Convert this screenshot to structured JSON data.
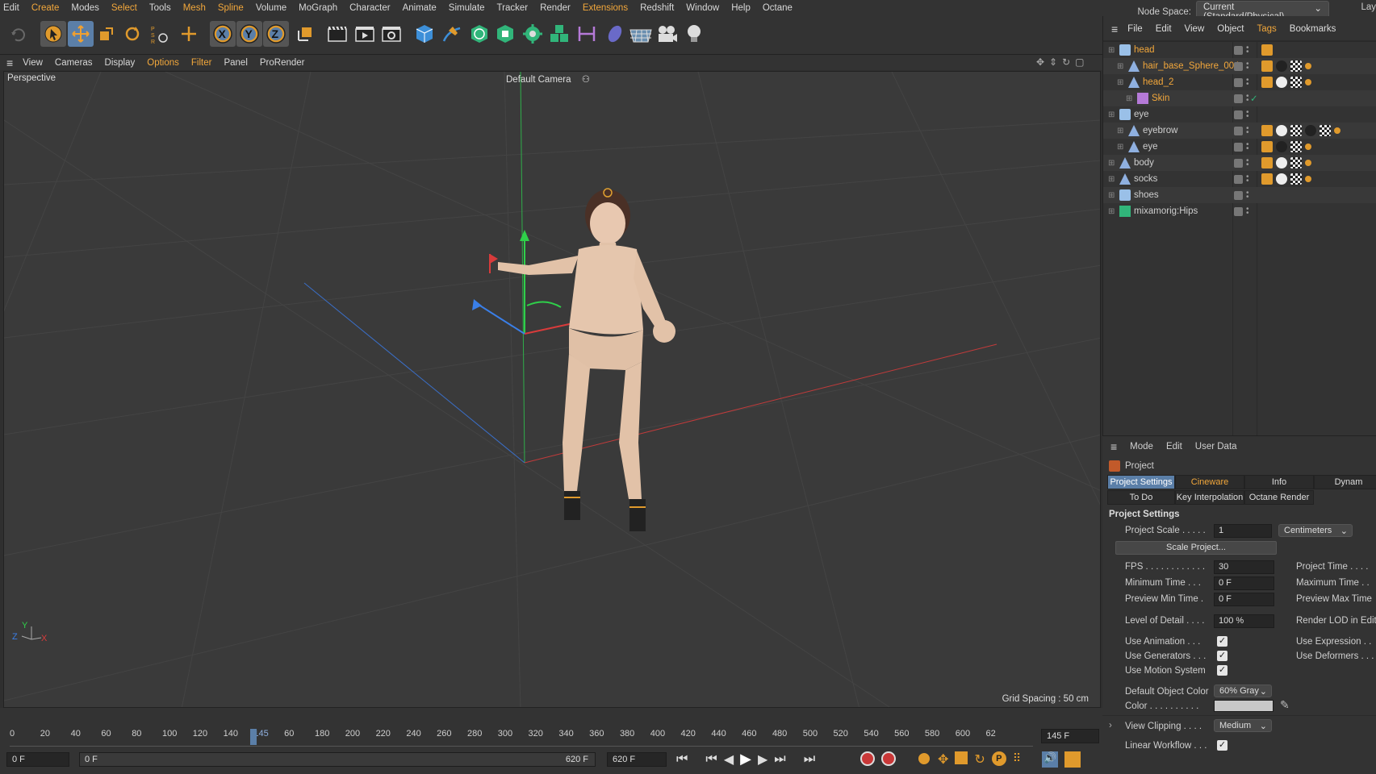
{
  "menubar": {
    "items": [
      "Edit",
      "Create",
      "Modes",
      "Select",
      "Tools",
      "Mesh",
      "Spline",
      "Volume",
      "MoGraph",
      "Character",
      "Animate",
      "Simulate",
      "Tracker",
      "Render",
      "Extensions",
      "Redshift",
      "Window",
      "Help",
      "Octane"
    ],
    "highlighted": [
      "Create",
      "Select",
      "Mesh",
      "Spline",
      "Extensions"
    ],
    "node_space_label": "Node Space:",
    "node_space_value": "Current (Standard/Physical)",
    "layout_label": "Lay"
  },
  "toolbar": {
    "icons": [
      "undo-icon",
      "select-icon",
      "move-icon",
      "scale-icon",
      "rotate-icon",
      "psr-icon",
      "transform-icon",
      "x-axis-icon",
      "y-axis-icon",
      "z-axis-icon",
      "coord-system-icon",
      "render-view-icon",
      "render-picture-icon",
      "render-settings-icon",
      "cube-icon",
      "pen-icon",
      "subdivision-icon",
      "extrude-icon",
      "cloner-icon",
      "mograph-icon",
      "deformer-icon",
      "field-icon",
      "floor-icon",
      "camera-icon",
      "light-icon"
    ]
  },
  "viewport_menu": {
    "items": [
      "View",
      "Cameras",
      "Display",
      "Options",
      "Filter",
      "Panel",
      "ProRender"
    ],
    "highlighted": [
      "Options",
      "Filter"
    ]
  },
  "viewport": {
    "view_name": "Perspective",
    "camera": "Default Camera",
    "grid_spacing": "Grid Spacing : 50 cm",
    "axis_labels": [
      "Y",
      "Z",
      "X"
    ]
  },
  "timeline": {
    "ticks": [
      "0",
      "20",
      "40",
      "60",
      "80",
      "100",
      "120",
      "140",
      "145",
      "60",
      "180",
      "200",
      "220",
      "240",
      "260",
      "280",
      "300",
      "320",
      "340",
      "360",
      "380",
      "400",
      "420",
      "440",
      "460",
      "480",
      "500",
      "520",
      "540",
      "560",
      "580",
      "600",
      "62"
    ],
    "current_frame": "145",
    "end_field": "145 F",
    "start_field": "0 F",
    "range_start": "0 F",
    "range_end": "620 F",
    "max_field": "620 F"
  },
  "object_manager": {
    "menu": [
      "File",
      "Edit",
      "View",
      "Object",
      "Tags",
      "Bookmarks"
    ],
    "highlighted": [
      "Tags"
    ],
    "objects": [
      {
        "name": "head",
        "indent": 0,
        "orange": true,
        "icon": "null-icon"
      },
      {
        "name": "hair_base_Sphere_004",
        "indent": 1,
        "orange": true,
        "icon": "polygon-icon"
      },
      {
        "name": "head_2",
        "indent": 1,
        "orange": true,
        "icon": "polygon-icon"
      },
      {
        "name": "Skin",
        "indent": 2,
        "orange": true,
        "icon": "skin-icon"
      },
      {
        "name": "eye",
        "indent": 0,
        "orange": false,
        "icon": "null-icon"
      },
      {
        "name": "eyebrow",
        "indent": 1,
        "orange": false,
        "icon": "polygon-icon"
      },
      {
        "name": "eye",
        "indent": 1,
        "orange": false,
        "icon": "polygon-icon"
      },
      {
        "name": "body",
        "indent": 0,
        "orange": false,
        "icon": "polygon-icon"
      },
      {
        "name": "socks",
        "indent": 0,
        "orange": false,
        "icon": "polygon-icon"
      },
      {
        "name": "shoes",
        "indent": 0,
        "orange": false,
        "icon": "null-icon"
      },
      {
        "name": "mixamorig:Hips",
        "indent": 0,
        "orange": false,
        "icon": "joint-icon"
      }
    ]
  },
  "attributes": {
    "menu": [
      "Mode",
      "Edit",
      "User Data"
    ],
    "object_name": "Project",
    "tabs_row1": [
      "Project Settings",
      "Cineware",
      "Info",
      "Dynam"
    ],
    "tabs_row2": [
      "To Do",
      "Key Interpolation",
      "Octane Render"
    ],
    "section": "Project Settings",
    "project_scale_label": "Project Scale . . . . .",
    "project_scale_value": "1",
    "project_scale_unit": "Centimeters",
    "scale_button": "Scale Project...",
    "fps_label": "FPS . . . . . . . . . . . .",
    "fps_value": "30",
    "min_time_label": "Minimum Time . . .",
    "min_time_value": "0 F",
    "preview_min_label": "Preview Min Time .",
    "preview_min_value": "0 F",
    "lod_label": "Level of Detail . . . .",
    "lod_value": "100 %",
    "project_time_label": "Project Time . . . .",
    "max_time_label": "Maximum Time . .",
    "preview_max_label": "Preview Max Time",
    "render_lod_label": "Render LOD in Edit",
    "use_animation_label": "Use Animation . . .",
    "use_generators_label": "Use Generators . . .",
    "use_motion_label": "Use Motion System",
    "use_expression_label": "Use Expression . .",
    "use_deformers_label": "Use Deformers . . .",
    "default_color_label": "Default Object Color",
    "default_color_value": "60% Gray",
    "color_label": "Color . . . . . . . . . .",
    "view_clipping_label": "View Clipping . . . .",
    "view_clipping_value": "Medium",
    "linear_workflow_label": "Linear Workflow . . ."
  }
}
